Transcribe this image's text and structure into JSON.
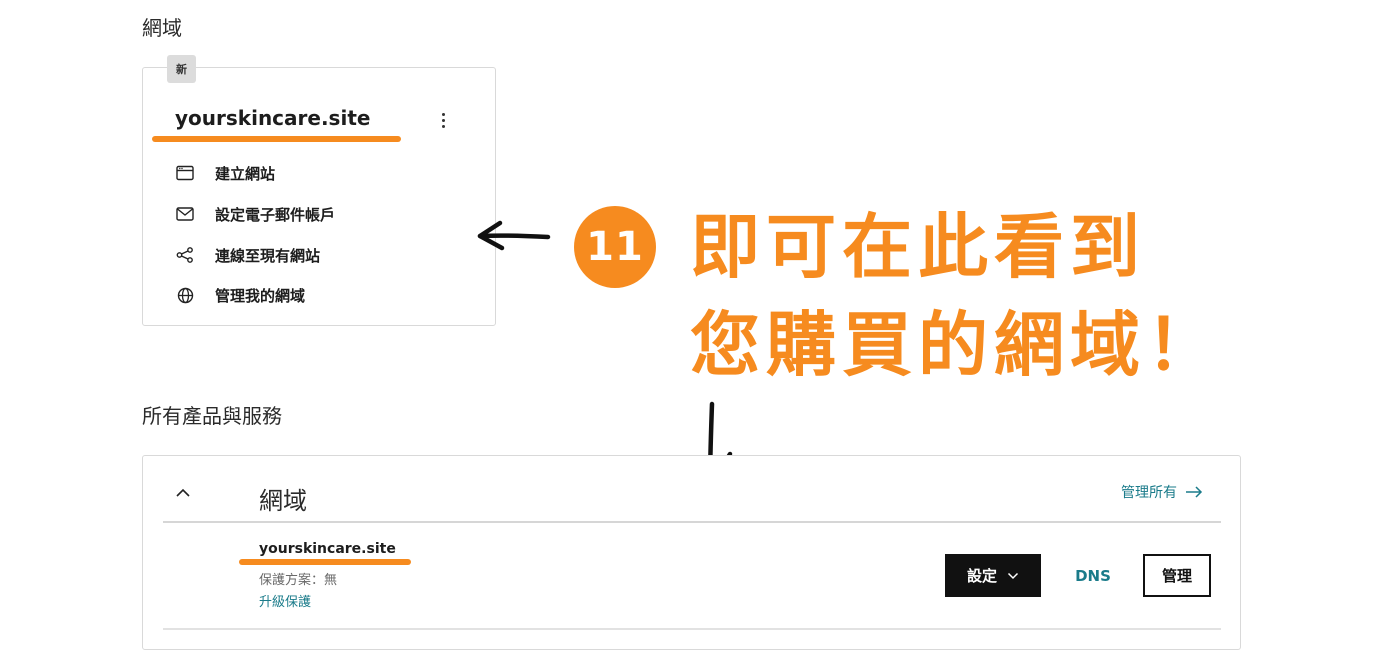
{
  "domains_section": {
    "title": "網域",
    "card": {
      "badge": "新",
      "domain": "yourskincare.site",
      "more_icon": "kebab-menu-icon",
      "actions": [
        {
          "label": "建立網站",
          "icon": "browser-window-icon"
        },
        {
          "label": "設定電子郵件帳戶",
          "icon": "mail-icon"
        },
        {
          "label": "連線至現有網站",
          "icon": "share-nodes-icon"
        },
        {
          "label": "管理我的網域",
          "icon": "globe-icon"
        }
      ]
    }
  },
  "annotation": {
    "step_number": "11",
    "line1": "即可在此看到",
    "line2": "您購買的網域！",
    "color": "#f68b1f"
  },
  "products_section": {
    "title": "所有產品與服務",
    "panel": {
      "title": "網域",
      "manage_all": "管理所有",
      "row": {
        "domain": "yourskincare.site",
        "plan": "保護方案：無",
        "upgrade": "升級保護",
        "settings_label": "設定",
        "dns_label": "DNS",
        "manage_label": "管理"
      }
    }
  },
  "colors": {
    "accent_teal": "#1a7b8a",
    "highlight_orange": "#f68b1f",
    "button_dark": "#111111"
  }
}
